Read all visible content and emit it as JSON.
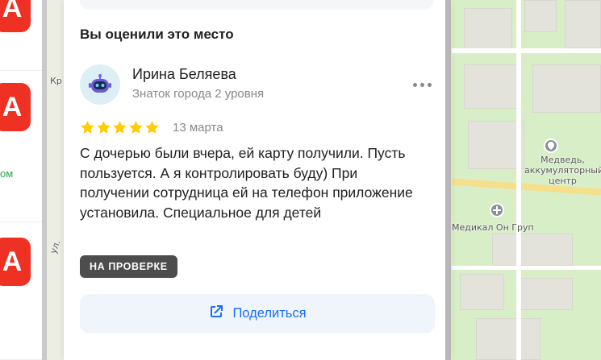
{
  "review_section": {
    "title": "Вы оценили это место"
  },
  "review": {
    "author_name": "Ирина Беляева",
    "author_level": "Знаток города 2 уровня",
    "rating": 5,
    "rating_max": 5,
    "date": "13 марта",
    "text": "С дочерью были вчера, ей карту получили. Пусть пользуется. А я контролировать буду) При получении сотрудница ей на телефон приложение установила. Специальное для детей",
    "status_badge": "НА ПРОВЕРКЕ",
    "share_label": "Поделиться"
  },
  "map": {
    "label_medved": "Медведь, аккумуляторный центр",
    "label_medical": "Медикал Он Груп",
    "fragment_kr": "Кр",
    "fragment_ul": "ул."
  },
  "left_list": {
    "link_fragment": "ом",
    "logo_glyph": "А"
  },
  "colors": {
    "accent_blue": "#196dff",
    "star_gold": "#fc0",
    "badge_dark": "#4d4d4d",
    "brand_red": "#ef3124"
  },
  "icons": {
    "more": "more-dots-icon",
    "share": "share-icon",
    "avatar": "robot-avatar-icon",
    "star": "star-icon"
  }
}
